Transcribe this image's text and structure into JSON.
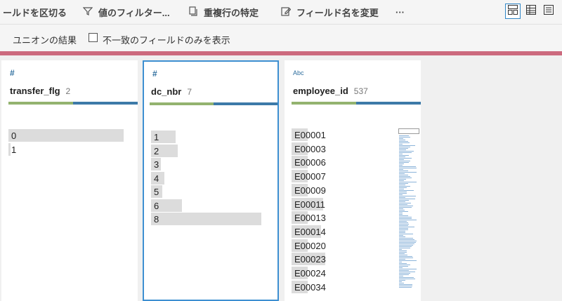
{
  "toolbar": {
    "items": [
      {
        "label": "ールドを区切る",
        "icon": ""
      },
      {
        "label": "値のフィルター...",
        "icon": "filter-icon"
      },
      {
        "label": "重複行の特定",
        "icon": "duplicate-icon"
      },
      {
        "label": "フィールド名を変更",
        "icon": "rename-icon"
      },
      {
        "label": "···",
        "icon": ""
      }
    ],
    "views": [
      "card-view-icon",
      "list-view-icon",
      "detail-view-icon"
    ]
  },
  "subbar": {
    "title": "ユニオンの結果",
    "checkbox_label": "不一致のフィールドのみを表示",
    "checked": false
  },
  "colors": {
    "accent": "#3d8fd1",
    "pink": "#cc6a7e",
    "green": "#93b36f",
    "blue": "#3d7aa8",
    "bar": "#dcdcdc"
  },
  "fields": [
    {
      "type": "#",
      "name": "transfer_flg",
      "count": "2",
      "quality": [
        0.5,
        0.5
      ],
      "values": [
        {
          "v": "0",
          "f": 0.94
        },
        {
          "v": "1",
          "f": 0.02
        }
      ]
    },
    {
      "type": "#",
      "name": "dc_nbr",
      "count": "7",
      "quality": [
        0.5,
        0.5
      ],
      "values": [
        {
          "v": "1",
          "f": 0.2
        },
        {
          "v": "2",
          "f": 0.22
        },
        {
          "v": "3",
          "f": 0.08
        },
        {
          "v": "4",
          "f": 0.11
        },
        {
          "v": "5",
          "f": 0.09
        },
        {
          "v": "6",
          "f": 0.25
        },
        {
          "v": "8",
          "f": 0.9
        }
      ]
    },
    {
      "type": "Abc",
      "name": "employee_id",
      "count": "537",
      "quality": [
        0.5,
        0.5
      ],
      "values": [
        {
          "v": "E00001",
          "f": 0.15
        },
        {
          "v": "E00003",
          "f": 0.15
        },
        {
          "v": "E00006",
          "f": 0.15
        },
        {
          "v": "E00007",
          "f": 0.15
        },
        {
          "v": "E00009",
          "f": 0.15
        },
        {
          "v": "E00011",
          "f": 0.3
        },
        {
          "v": "E00013",
          "f": 0.15
        },
        {
          "v": "E00014",
          "f": 0.28
        },
        {
          "v": "E00020",
          "f": 0.15
        },
        {
          "v": "E00023",
          "f": 0.32
        },
        {
          "v": "E00024",
          "f": 0.15
        },
        {
          "v": "E00034",
          "f": 0.15
        }
      ]
    }
  ]
}
